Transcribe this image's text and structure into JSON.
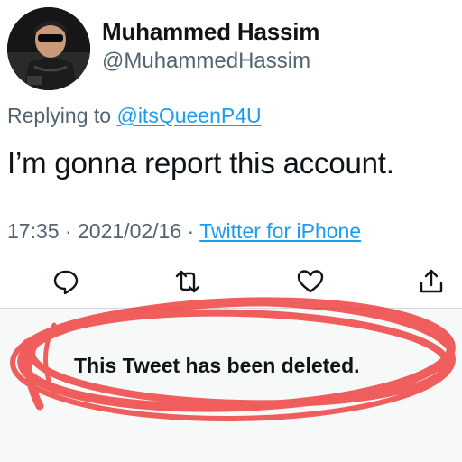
{
  "author": {
    "display_name": "Muhammed Hassim",
    "handle": "@MuhammedHassim",
    "avatar_icon": "profile-photo"
  },
  "reply": {
    "prefix": "Replying to ",
    "to": "@itsQueenP4U"
  },
  "tweet": {
    "text": "I’m gonna report this account.",
    "time": "17:35",
    "separator": " · ",
    "date": "2021/02/16",
    "source": "Twitter for iPhone"
  },
  "actions": [
    {
      "name": "reply",
      "icon": "speech-bubble-icon"
    },
    {
      "name": "retweet",
      "icon": "retweet-icon"
    },
    {
      "name": "like",
      "icon": "heart-icon"
    },
    {
      "name": "share",
      "icon": "share-icon"
    }
  ],
  "deleted_notice": {
    "text": "This Tweet has been deleted."
  },
  "colors": {
    "primary_text": "#0f1419",
    "secondary_text": "#536471",
    "link": "#1d9bf0",
    "scribble": "#ef3b3b",
    "panel_bg": "#f7f9f9"
  }
}
